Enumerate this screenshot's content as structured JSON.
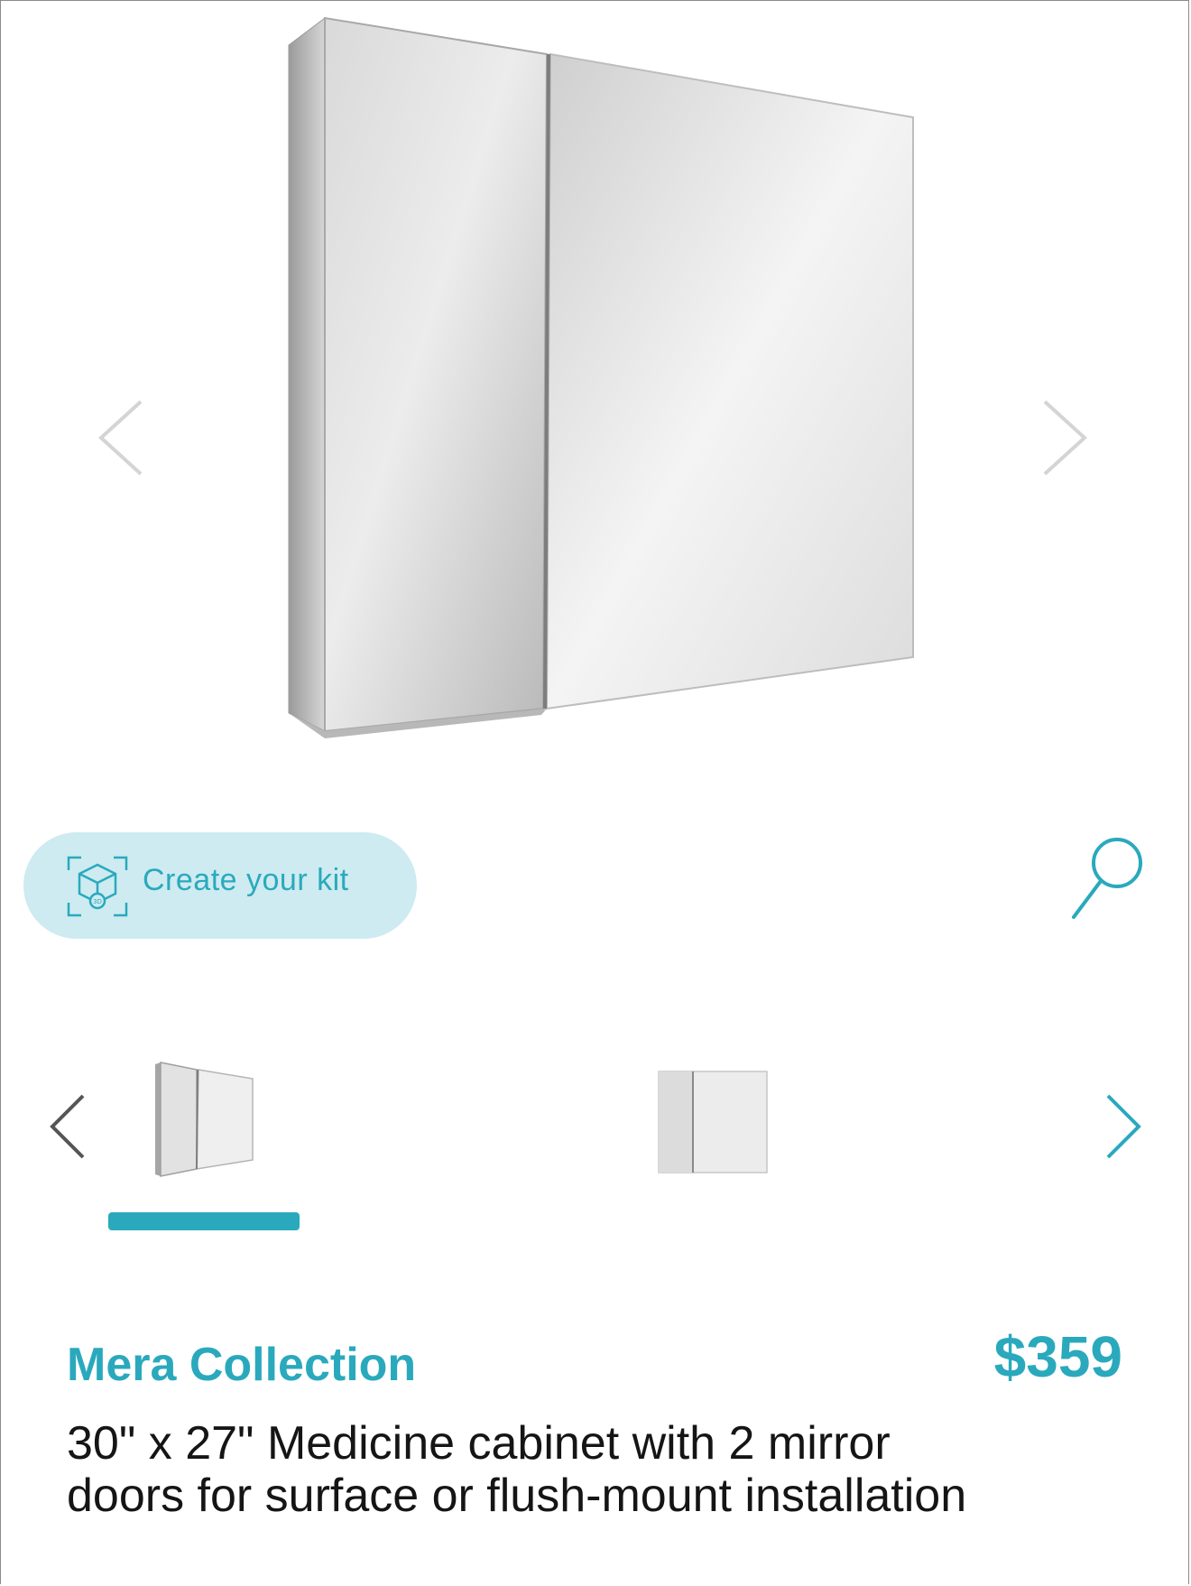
{
  "hero": {
    "image_alt": "Mera medicine cabinet with two mirror doors",
    "prev_icon": "chevron-left-icon",
    "next_icon": "chevron-right-icon"
  },
  "actions": {
    "create_kit_label": "Create your kit",
    "create_kit_icon": "3d-cube-scan-icon",
    "zoom_icon": "magnifier-icon"
  },
  "thumbnails": {
    "selected_index": 0,
    "items": [
      {
        "icon": "cabinet-angled-thumbnail"
      },
      {
        "icon": "cabinet-front-thumbnail"
      }
    ]
  },
  "product": {
    "collection": "Mera Collection",
    "price": "$359",
    "title": "30\" x 27\" Medicine cabinet with 2 mirror doors for surface or flush-mount installation"
  },
  "colors": {
    "accent": "#2aa9bd",
    "accent_light": "#cdebf0",
    "text": "#151515"
  }
}
